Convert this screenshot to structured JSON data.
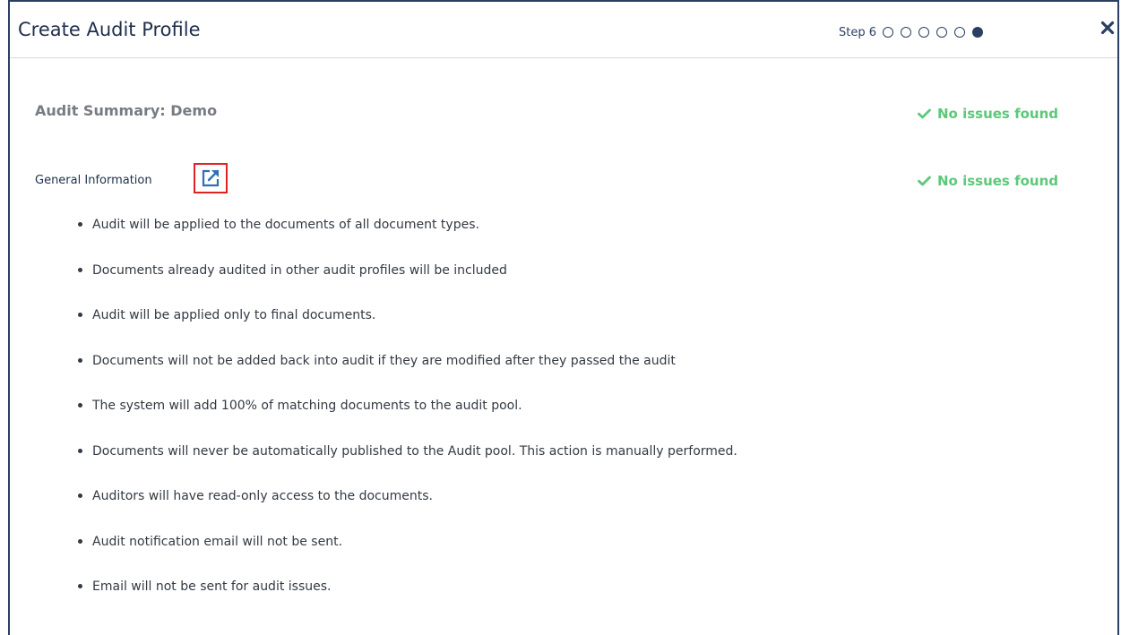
{
  "dialog": {
    "title": "Create Audit Profile",
    "step_label": "Step 6",
    "steps_total": 6,
    "current_step": 6
  },
  "summary": {
    "title": "Audit Summary: Demo",
    "status": "No issues found"
  },
  "general_information": {
    "title": "General Information",
    "status": "No issues found",
    "items": [
      "Audit will be applied to the documents of all document types.",
      "Documents already audited in other audit profiles will be included",
      "Audit will be applied only to final documents.",
      "Documents will not be added back into audit if they are modified after they passed the audit",
      "The system will add 100% of matching documents to the audit pool.",
      "Documents will never be automatically published to the Audit pool. This action is manually performed.",
      "Auditors will have read-only access to the documents.",
      "Audit notification email will not be sent.",
      "Email will not be sent for audit issues."
    ]
  },
  "colors": {
    "primary": "#2b3f63",
    "success": "#5cc879",
    "highlight": "#e12222",
    "muted_text": "#777c84"
  },
  "icons": {
    "close": "close-icon",
    "check": "check-icon",
    "edit": "external-link-icon"
  }
}
